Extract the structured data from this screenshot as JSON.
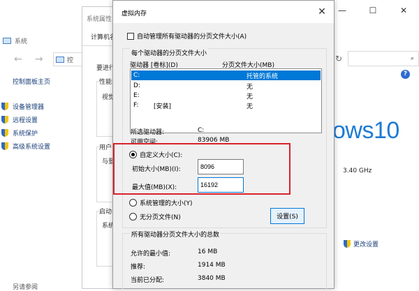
{
  "background_window": {
    "title": "系统",
    "nav": {
      "back": "←",
      "forward": "→",
      "up": "↑"
    },
    "address": "控",
    "refresh_icon": "↻",
    "search_icon": "⌕",
    "window_controls": {
      "minimize": "—",
      "maximize": "☐",
      "close": "✕"
    },
    "help_icon": "?",
    "sidebar": {
      "home": "控制面板主页",
      "items": [
        {
          "label": "设备管理器",
          "icon": "shield-icon"
        },
        {
          "label": "远程设置",
          "icon": "shield-icon"
        },
        {
          "label": "系统保护",
          "icon": "shield-icon"
        },
        {
          "label": "高级系统设置",
          "icon": "shield-icon"
        }
      ],
      "see_also": "另请参阅"
    },
    "windows_logo_text": "ows10",
    "cpu_speed": "3.40 GHz",
    "change_settings": "更改设置"
  },
  "properties_window": {
    "title": "系统属性",
    "tab": "计算机名",
    "text_need": "要进行",
    "group_performance": "性能",
    "perf_text": "视觉",
    "group_user": "用户",
    "user_text": "与登",
    "group_startup": "启动",
    "startup_text": "系统"
  },
  "dialog": {
    "title": "虚拟内存",
    "close_icon": "✕",
    "auto_manage_label": "自动管理所有驱动器的分页文件大小(A)",
    "auto_manage_checked": false,
    "group_each_drive": "每个驱动器的分页文件大小",
    "columns": {
      "drive": "驱动器 [卷标](D)",
      "paging": "分页文件大小(MB)"
    },
    "drives": [
      {
        "drive": "C:",
        "label": "",
        "size": "托管的系统",
        "selected": true
      },
      {
        "drive": "D:",
        "label": "",
        "size": "无",
        "selected": false
      },
      {
        "drive": "E:",
        "label": "",
        "size": "无",
        "selected": false
      },
      {
        "drive": "F:",
        "label": "[安装]",
        "size": "无",
        "selected": false
      }
    ],
    "selected_drive_label": "所选驱动器:",
    "selected_drive_value": "C:",
    "free_space_label": "可用空间:",
    "free_space_value": "83906 MB",
    "custom_size_label": "自定义大小(C):",
    "initial_size_label": "初始大小(MB)(I):",
    "initial_size_value": "8096",
    "max_size_label": "最大值(MB)(X):",
    "max_size_value": "16192",
    "system_managed_label": "系统管理的大小(Y)",
    "no_paging_label": "无分页文件(N)",
    "set_button": "设置(S)",
    "group_total": "所有驱动器分页文件大小的总数",
    "min_allowed_label": "允许的最小值:",
    "min_allowed_value": "16 MB",
    "recommended_label": "推荐:",
    "recommended_value": "1914 MB",
    "current_label": "当前已分配:",
    "current_value": "3840 MB"
  }
}
